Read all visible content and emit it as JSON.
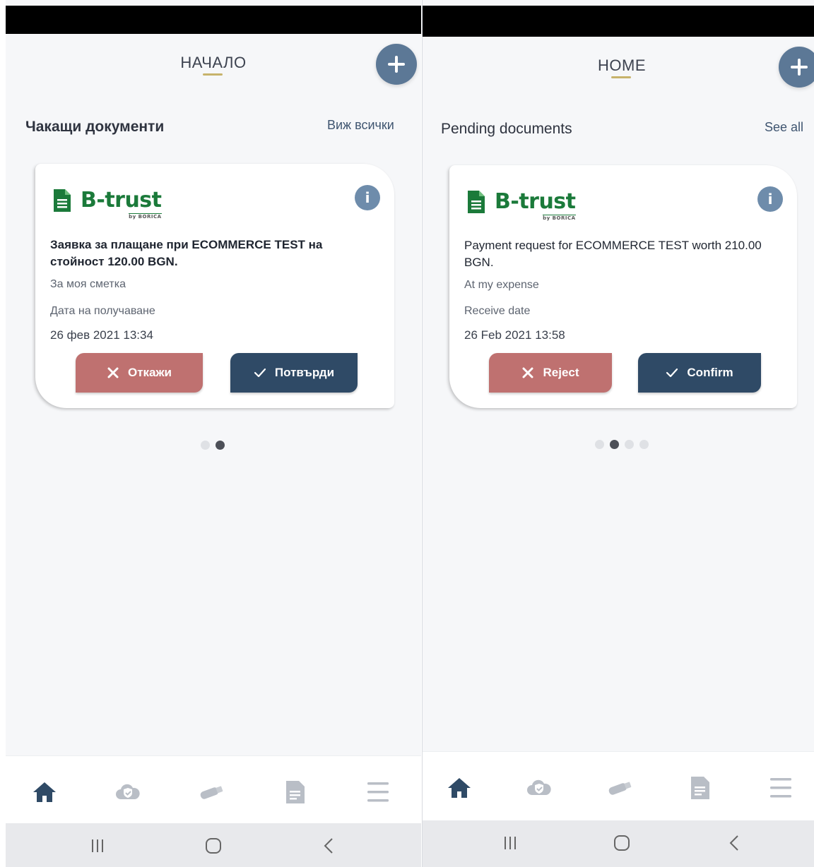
{
  "panels": {
    "bg": {
      "header_title": "НАЧАЛО",
      "section_title": "Чакащи документи",
      "see_all": "Виж всички",
      "card": {
        "logo_text": "B-trust",
        "logo_sub": "by BORICA",
        "info_icon": "i",
        "description": "Заявка за плащане при ECOMMERCE TEST на стойност 120.00 BGN.",
        "expense": "За моя сметка",
        "receive_label": "Дата на получаване",
        "datetime": "26 фев 2021 13:34",
        "reject_label": "Откажи",
        "confirm_label": "Потвърди"
      },
      "page_dots": {
        "count": 2,
        "active_index": 1
      }
    },
    "en": {
      "header_title": "HOME",
      "section_title": "Pending documents",
      "see_all": "See all",
      "card": {
        "logo_text": "B-trust",
        "logo_sub": "by BORICA",
        "info_icon": "i",
        "description": "Payment request for ECOMMERCE TEST worth 210.00 BGN.",
        "expense": "At my expense",
        "receive_label": "Receive date",
        "datetime": "26 Feb 2021 13:58",
        "reject_label": "Reject",
        "confirm_label": "Confirm"
      },
      "page_dots": {
        "count": 4,
        "active_index": 1
      }
    }
  },
  "bottom_nav_icons": [
    "home-icon",
    "cloud-shield-icon",
    "usb-token-icon",
    "document-icon",
    "menu-icon"
  ],
  "system_nav_icons": [
    "recent-apps-icon",
    "home-circle-icon",
    "back-icon"
  ],
  "colors": {
    "accent_blue": "#5c7896",
    "confirm": "#2f4a66",
    "reject": "#bf7170",
    "brand_green": "#1b7a3a",
    "underline_gold": "#c7b36b"
  }
}
